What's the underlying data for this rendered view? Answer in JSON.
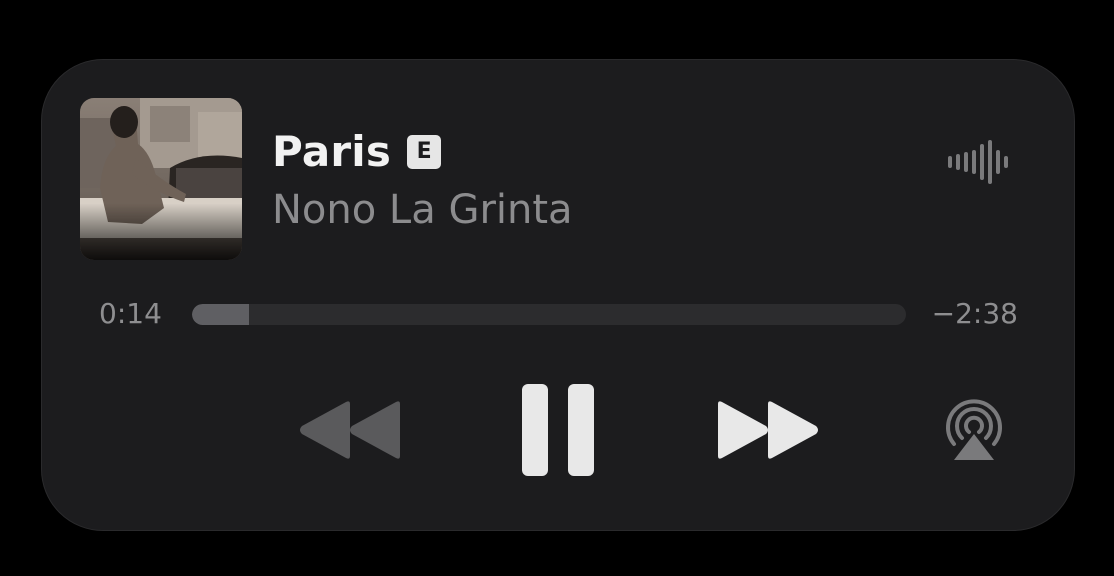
{
  "now_playing": {
    "title": "Paris",
    "explicit_badge": "E",
    "artist": "Nono La Grinta",
    "elapsed": "0:14",
    "remaining": "−2:38",
    "progress": 0.08
  },
  "icons": {
    "waveform": "waveform-icon",
    "rewind": "backward-icon",
    "pause": "pause-icon",
    "forward": "forward-icon",
    "airplay": "airplay-icon"
  },
  "colors": {
    "background": "#000000",
    "card": "#1c1c1e",
    "title": "#f2f2f2",
    "artist": "#8c8c8e",
    "track": "#2c2c2e",
    "fill": "#5f5f63",
    "control_active": "#e8e8e8",
    "control_disabled": "#5a5a5c"
  }
}
